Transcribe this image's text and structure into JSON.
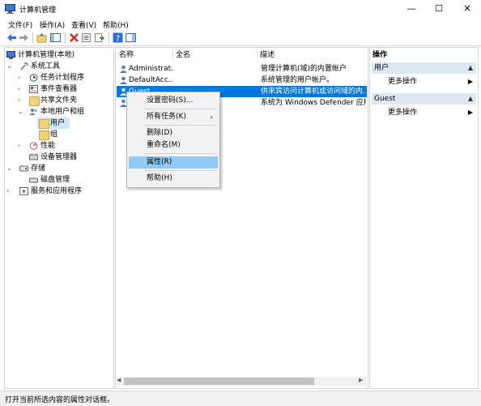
{
  "title_bar": {
    "title": "计算机管理"
  },
  "menu": [
    "文件(F)",
    "操作(A)",
    "查看(V)",
    "帮助(H)"
  ],
  "tree": [
    {
      "label": "计算机管理(本地)"
    },
    {
      "label": "系统工具"
    },
    {
      "label": "任务计划程序"
    },
    {
      "label": "事件查看器"
    },
    {
      "label": "共享文件夹"
    },
    {
      "label": "本地用户和组"
    },
    {
      "label": "用户"
    },
    {
      "label": "组"
    },
    {
      "label": "性能"
    },
    {
      "label": "设备管理器"
    },
    {
      "label": "存储"
    },
    {
      "label": "磁盘管理"
    },
    {
      "label": "服务和应用程序"
    }
  ],
  "list": {
    "columns": [
      "名称",
      "全名",
      "描述"
    ],
    "rows": [
      {
        "name": "Administrat...",
        "full_name": "",
        "description": "管理计算机(域)的内置帐户"
      },
      {
        "name": "DefaultAcc...",
        "full_name": "",
        "description": "系统管理的用户帐户。"
      },
      {
        "name": "Guest",
        "full_name": "",
        "description": "供来宾访问计算机或访问域的内..."
      },
      {
        "name": "",
        "full_name": "",
        "description": "系统为 Windows Defender 应用..."
      }
    ]
  },
  "context_menu": {
    "items": [
      "设置密码(S)...",
      "所有任务(K)",
      "删除(D)",
      "重命名(M)",
      "属性(R)",
      "帮助(H)"
    ]
  },
  "actions_pane": {
    "header": "操作",
    "sections": [
      {
        "title": "用户",
        "item": "更多操作"
      },
      {
        "title": "Guest",
        "item": "更多操作"
      }
    ]
  },
  "status_bar": {
    "text": "打开当前所选内容的属性对话框。"
  },
  "colors": {
    "selection": "#0078d7",
    "menu_highlight": "#91c9f7",
    "tree_selection": "#cce8ff"
  }
}
